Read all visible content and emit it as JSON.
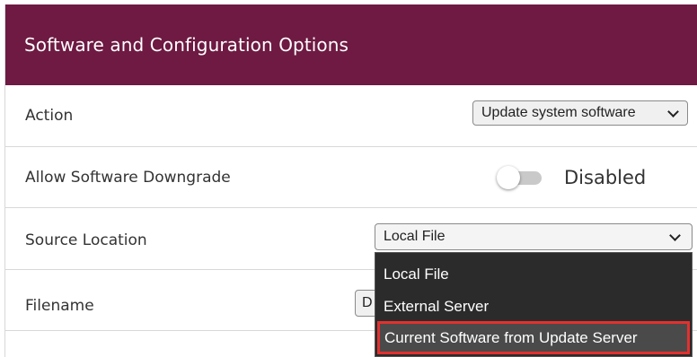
{
  "header": {
    "title": "Software and Configuration Options"
  },
  "rows": {
    "action": {
      "label": "Action",
      "value": "Update system software"
    },
    "downgrade": {
      "label": "Allow Software Downgrade",
      "toggle_on": false,
      "state": "Disabled"
    },
    "source": {
      "label": "Source Location",
      "value": "Local File",
      "options": [
        "Local File",
        "External Server",
        "Current Software from Update Server"
      ],
      "highlighted_option": "Current Software from Update Server"
    },
    "filename": {
      "label": "Filename",
      "value_partial": "D"
    }
  },
  "colors": {
    "header_bg": "#6e1a42",
    "dropdown_bg": "#2b2b2b",
    "highlight_border": "#e2312f",
    "toggle_track": "#c9c9c9"
  },
  "icons": [
    "chevron-down-icon"
  ]
}
